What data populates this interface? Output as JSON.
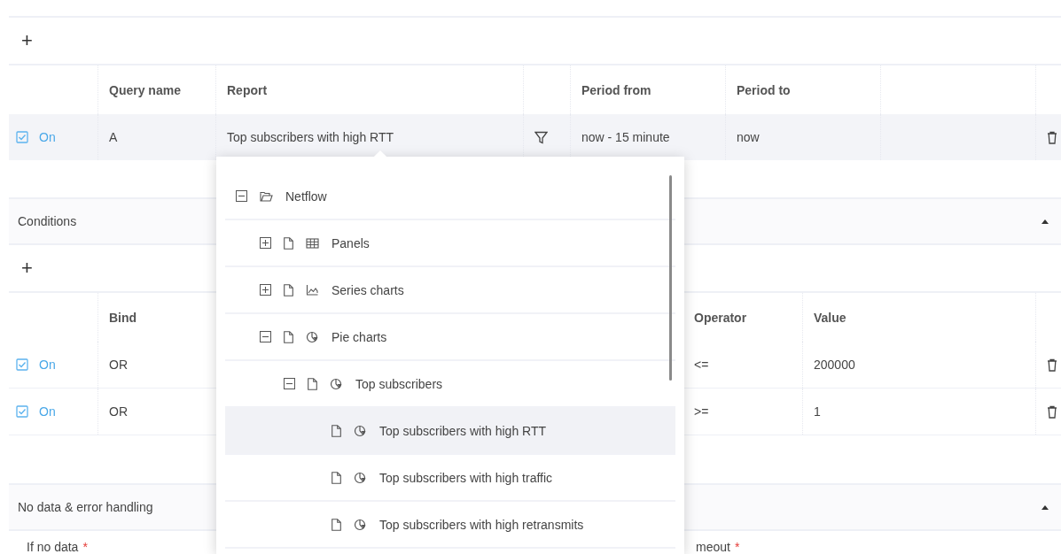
{
  "queries": {
    "add_button": "+",
    "columns": [
      "Query name",
      "Report",
      "Period from",
      "Period to"
    ],
    "rows": [
      {
        "enabled": true,
        "status": "On",
        "query_name": "A",
        "report": "Top subscribers with high RTT",
        "period_from": "now - 15 minute",
        "period_to": "now",
        "selected": true
      }
    ]
  },
  "conditions": {
    "title": "Conditions",
    "expanded": true,
    "add_button": "+",
    "columns": [
      "Bind",
      "Operator",
      "Value"
    ],
    "rows": [
      {
        "enabled": true,
        "status": "On",
        "bind": "OR",
        "operator": "<=",
        "value": "200000"
      },
      {
        "enabled": true,
        "status": "On",
        "bind": "OR",
        "operator": ">=",
        "value": "1"
      }
    ]
  },
  "no_data_section": {
    "title": "No data & error handling",
    "expanded": true,
    "fields": [
      {
        "label": "If no data",
        "required_mark": "*"
      },
      {
        "label": "meout",
        "required_mark": "*"
      }
    ]
  },
  "report_dropdown": {
    "tree": [
      {
        "label": "Netflow",
        "kind": "folder",
        "expanded": true,
        "selected": false,
        "children": [
          {
            "label": "Panels",
            "kind": "table",
            "expanded": false,
            "selected": false
          },
          {
            "label": "Series charts",
            "kind": "series",
            "expanded": false,
            "selected": false
          },
          {
            "label": "Pie charts",
            "kind": "pie",
            "expanded": true,
            "selected": false,
            "children": [
              {
                "label": "Top subscribers",
                "kind": "pie",
                "expanded": true,
                "selected": false,
                "children": [
                  {
                    "label": "Top subscribers with high RTT",
                    "kind": "pie",
                    "selected": true
                  },
                  {
                    "label": "Top subscribers with high traffic",
                    "kind": "pie",
                    "selected": false
                  },
                  {
                    "label": "Top subscribers with high retransmits",
                    "kind": "pie",
                    "selected": false
                  }
                ]
              }
            ]
          }
        ]
      }
    ]
  }
}
